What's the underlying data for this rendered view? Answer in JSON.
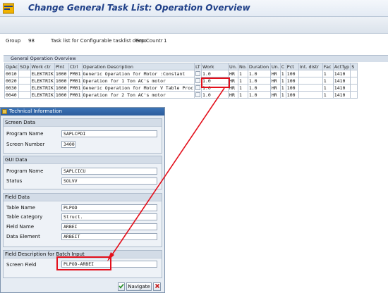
{
  "window": {
    "title": "Change General Task List: Operation Overview"
  },
  "header": {
    "group_label": "Group",
    "group_value": "98",
    "description": "Task list for Configurable tasklist demo",
    "counter_label": "Grp.Countr",
    "counter_value": "1"
  },
  "table": {
    "panel_title": "General Operation Overview",
    "columns": [
      "OpAc",
      "SOp",
      "Work ctr",
      "Plnt",
      "Ctrl",
      "Operation Description",
      "LT",
      "Work",
      "Un.",
      "No.",
      "Duration",
      "Un.",
      "C",
      "Pct",
      "Int. distr",
      "Fac",
      "ActTyp",
      "S"
    ],
    "rows": [
      [
        "0010",
        "",
        "ELEKTRIK",
        "1000",
        "PM01",
        "Generic Operation for Motor :Constant",
        "",
        "1.0",
        "HR",
        "1",
        "1.0",
        "HR",
        "1",
        "100",
        "",
        "1",
        "1410",
        ""
      ],
      [
        "0020",
        "",
        "ELEKTRIK",
        "1000",
        "PM01",
        "Operation for 1 Ton AC's motor",
        "",
        "1.0",
        "HR",
        "1",
        "1.0",
        "HR",
        "1",
        "100",
        "",
        "1",
        "1410",
        ""
      ],
      [
        "0030",
        "",
        "ELEKTRIK",
        "1000",
        "PM01",
        "Generic Operation for Motor V Table Proc",
        "",
        "1.0",
        "HR",
        "1",
        "1.0",
        "HR",
        "1",
        "100",
        "",
        "1",
        "1410",
        ""
      ],
      [
        "0040",
        "",
        "ELEKTRIK",
        "1000",
        "PM01",
        "Operation for 2 Ton AC's motor",
        "",
        "1.0",
        "HR",
        "1",
        "1.0",
        "HR",
        "1",
        "100",
        "",
        "1",
        "1410",
        ""
      ]
    ]
  },
  "dialog": {
    "title": "Technical Information",
    "screen_data": {
      "heading": "Screen Data",
      "program_name_label": "Program Name",
      "program_name_value": "SAPLCPDI",
      "screen_number_label": "Screen Number",
      "screen_number_value": "3400"
    },
    "gui_data": {
      "heading": "GUI Data",
      "program_name_label": "Program Name",
      "program_name_value": "SAPLCICU",
      "status_label": "Status",
      "status_value": "SOLVV"
    },
    "field_data": {
      "heading": "Field Data",
      "table_name_label": "Table Name",
      "table_name_value": "PLPOD",
      "table_category_label": "Table category",
      "table_category_value": "Struct.",
      "field_name_label": "Field Name",
      "field_name_value": "ARBEI",
      "data_element_label": "Data Element",
      "data_element_value": "ARBEIT"
    },
    "batch_input": {
      "heading": "Field Description for Batch Input",
      "screen_field_label": "Screen Field",
      "screen_field_value": "PLPOD-ARBEI"
    },
    "buttons": {
      "navigate": "Navigate"
    }
  },
  "colors": {
    "highlight": "#e3101c",
    "title_blue": "#1e3f88"
  }
}
